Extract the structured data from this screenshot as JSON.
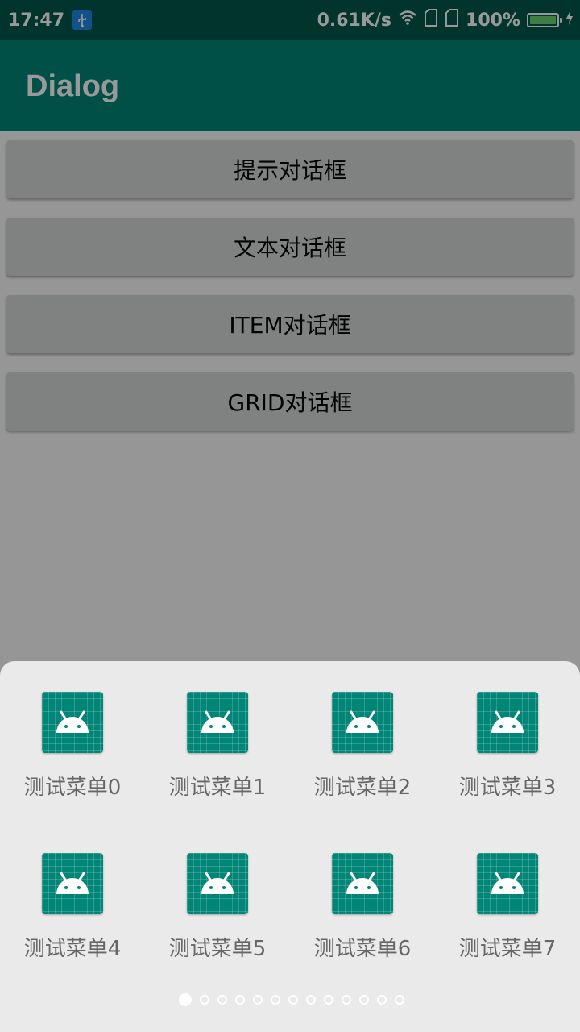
{
  "status_bar": {
    "time": "17:47",
    "network_speed": "0.61K/s",
    "battery": "100%",
    "icons": [
      "usb-icon",
      "wifi-icon",
      "sim-icon",
      "sim-icon",
      "battery-icon",
      "charging-icon"
    ]
  },
  "app_bar": {
    "title": "Dialog"
  },
  "buttons": [
    {
      "label": "提示对话框"
    },
    {
      "label": "文本对话框"
    },
    {
      "label": "ITEM对话框"
    },
    {
      "label": "GRID对话框"
    }
  ],
  "sheet": {
    "items": [
      {
        "label": "测试菜单0",
        "icon": "android-app-icon"
      },
      {
        "label": "测试菜单1",
        "icon": "android-app-icon"
      },
      {
        "label": "测试菜单2",
        "icon": "android-app-icon"
      },
      {
        "label": "测试菜单3",
        "icon": "android-app-icon"
      },
      {
        "label": "测试菜单4",
        "icon": "android-app-icon"
      },
      {
        "label": "测试菜单5",
        "icon": "android-app-icon"
      },
      {
        "label": "测试菜单6",
        "icon": "android-app-icon"
      },
      {
        "label": "测试菜单7",
        "icon": "android-app-icon"
      }
    ],
    "page_indicator": {
      "total": 13,
      "current": 1
    }
  },
  "colors": {
    "primary_dark": "#00574B",
    "primary": "#008577",
    "button_bg": "#d6d7d7",
    "sheet_bg": "#eaeaea"
  }
}
